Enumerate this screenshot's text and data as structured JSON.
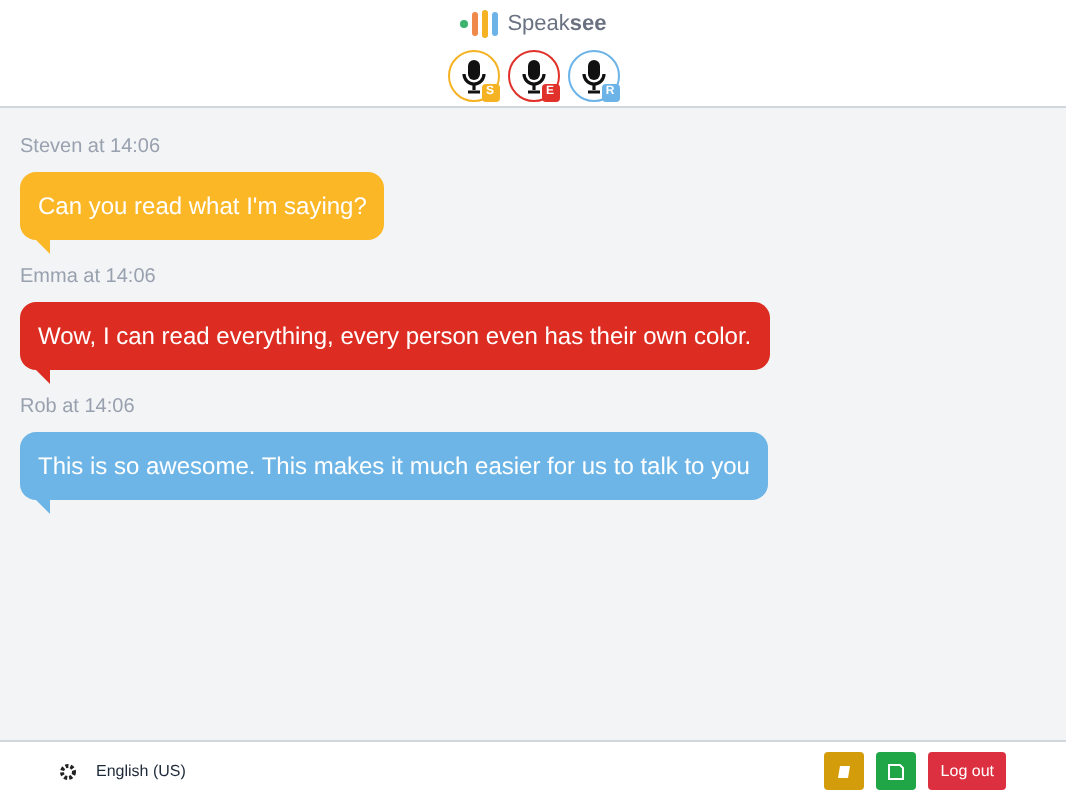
{
  "logo": {
    "text": "Speak**see**"
  },
  "speakers": [
    {
      "initial": "S",
      "color": "#f5b324"
    },
    {
      "initial": "E",
      "color": "#e0312b"
    },
    {
      "initial": "R",
      "color": "#6cb4e8"
    }
  ],
  "messages": [
    {
      "meta": "Steven at 14:06",
      "text": "Can you read what I'm saying?",
      "color": "#fbb726"
    },
    {
      "meta": "Emma at 14:06",
      "text": "Wow, I can read everything, every person even has their own color.",
      "color": "#dd2d22"
    },
    {
      "meta": "Rob at 14:06",
      "text": "This is so awesome. This makes it much easier for us to talk to you",
      "color": "#6db5e6"
    }
  ],
  "footer": {
    "language": "English (US)",
    "logout": "Log out"
  }
}
